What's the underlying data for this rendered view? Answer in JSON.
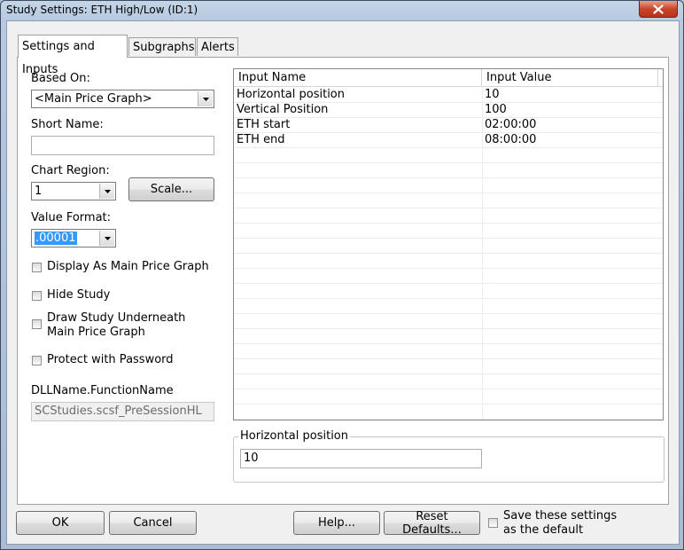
{
  "window": {
    "title": "Study Settings: ETH High/Low (ID:1)"
  },
  "tabs": [
    {
      "label": "Settings and Inputs"
    },
    {
      "label": "Subgraphs"
    },
    {
      "label": "Alerts"
    }
  ],
  "settings": {
    "based_on_label": "Based On:",
    "based_on_value": "<Main Price Graph>",
    "short_name_label": "Short Name:",
    "short_name_value": "",
    "chart_region_label": "Chart Region:",
    "chart_region_value": "1",
    "scale_button": "Scale...",
    "value_format_label": "Value Format:",
    "value_format_value": ".00001",
    "checkboxes": [
      {
        "label": "Display As Main Price Graph",
        "checked": false
      },
      {
        "label": "Hide Study",
        "checked": false
      },
      {
        "label": "Draw Study Underneath",
        "label2": "Main Price Graph",
        "checked": false
      },
      {
        "label": "Protect with Password",
        "checked": false
      }
    ],
    "dll_label": "DLLName.FunctionName",
    "dll_value": "SCStudies.scsf_PreSessionHL"
  },
  "inputs_table": {
    "columns": [
      "Input Name",
      "Input Value"
    ],
    "rows": [
      {
        "name": "Horizontal position",
        "value": "10"
      },
      {
        "name": "Vertical Position",
        "value": "100"
      },
      {
        "name": "ETH start",
        "value": "02:00:00"
      },
      {
        "name": "ETH end",
        "value": "08:00:00"
      }
    ]
  },
  "editor": {
    "label": "Horizontal position",
    "value": "10"
  },
  "footer": {
    "ok": "OK",
    "cancel": "Cancel",
    "help": "Help...",
    "reset": "Reset Defaults...",
    "save_default_line1": "Save these settings",
    "save_default_line2": "as the default"
  }
}
